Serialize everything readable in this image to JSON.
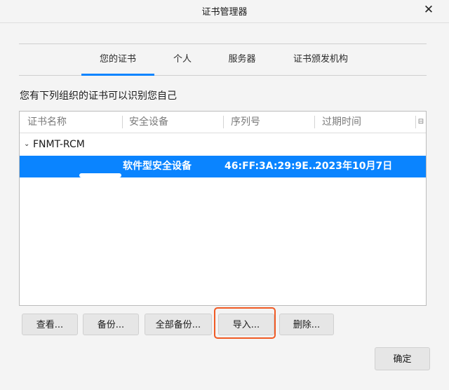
{
  "window": {
    "title": "证书管理器",
    "close_label": "✕"
  },
  "tabs": [
    {
      "label": "您的证书",
      "selected": true
    },
    {
      "label": "个人",
      "selected": false
    },
    {
      "label": "服务器",
      "selected": false
    },
    {
      "label": "证书颁发机构",
      "selected": false
    }
  ],
  "description": "您有下列组织的证书可以识别您自己",
  "table": {
    "columns": [
      "证书名称",
      "安全设备",
      "序列号",
      "过期时间"
    ],
    "column_picker_icon": "column-picker-icon",
    "groups": [
      {
        "name": "FNMT-RCM",
        "expanded": true,
        "rows": [
          {
            "name": "",
            "device": "软件型安全设备",
            "serial": "46:FF:3A:29:9E...",
            "expires": "2023年10月7日",
            "selected": true
          }
        ]
      }
    ]
  },
  "buttons": {
    "view": "查看...",
    "backup": "备份...",
    "backup_all": "全部备份...",
    "import": "导入...",
    "delete": "删除..."
  },
  "ok_label": "确定",
  "colors": {
    "accent": "#0a84ff",
    "highlight": "#f05a24"
  }
}
